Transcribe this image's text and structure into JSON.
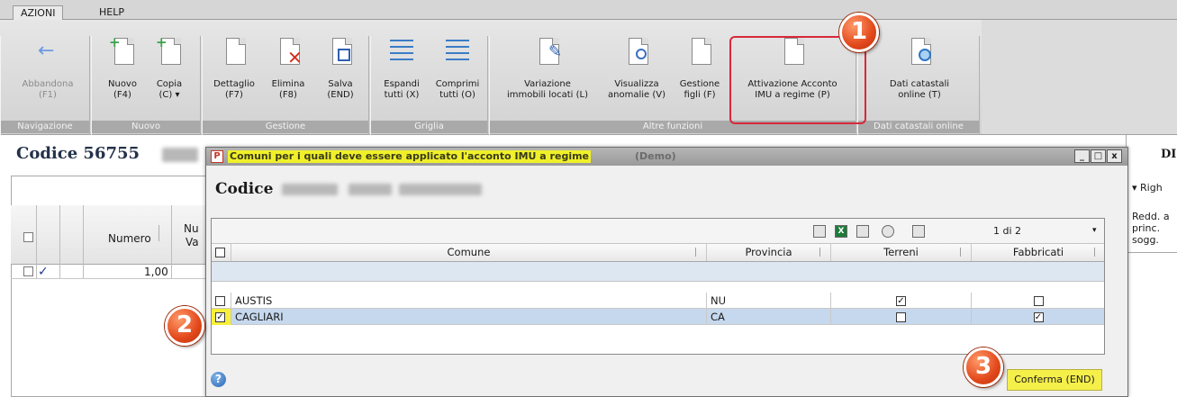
{
  "ribbon": {
    "tabs": [
      {
        "label": "AZIONI"
      },
      {
        "label": "HELP"
      }
    ],
    "groups": {
      "navigazione": {
        "label": "Navigazione",
        "buttons": [
          {
            "line1": "Abbandona",
            "line2": "(F1)"
          }
        ]
      },
      "nuovo": {
        "label": "Nuovo",
        "buttons": [
          {
            "line1": "Nuovo",
            "line2": "(F4)"
          },
          {
            "line1": "Copia",
            "line2": "(C) ▾"
          }
        ]
      },
      "gestione": {
        "label": "Gestione",
        "buttons": [
          {
            "line1": "Dettaglio",
            "line2": "(F7)"
          },
          {
            "line1": "Elimina",
            "line2": "(F8)"
          },
          {
            "line1": "Salva",
            "line2": "(END)"
          }
        ]
      },
      "griglia": {
        "label": "Griglia",
        "buttons": [
          {
            "line1": "Espandi",
            "line2": "tutti (X)"
          },
          {
            "line1": "Comprimi",
            "line2": "tutti (O)"
          }
        ]
      },
      "altre": {
        "label": "Altre funzioni",
        "buttons": [
          {
            "line1": "Variazione",
            "line2": "immobili locati (L)"
          },
          {
            "line1": "Visualizza",
            "line2": "anomalie (V)"
          },
          {
            "line1": "Gestione",
            "line2": "figli (F)"
          },
          {
            "line1": "Attivazione Acconto",
            "line2": "IMU a regime (P)"
          }
        ]
      },
      "catastali": {
        "label": "Dati catastali online",
        "buttons": [
          {
            "line1": "Dati catastali",
            "line2": "online (T)"
          }
        ]
      }
    }
  },
  "background": {
    "codice": "Codice 56755",
    "grid": {
      "col_numero": "Numero",
      "col_nu": "Nu",
      "col_va": "Va",
      "row_value": "1,00"
    },
    "right": {
      "header": "DI",
      "righe": "Righ",
      "redd_line1": "Redd. a",
      "redd_line2": "princ.",
      "redd_line3": "sogg."
    }
  },
  "badges": {
    "one": "1",
    "two": "2",
    "three": "3"
  },
  "dialog": {
    "title": "Comuni per i quali deve essere applicato l'acconto IMU a regime",
    "title_suffix": "(Demo)",
    "app_icon": "P",
    "winbtn_min": "_",
    "winbtn_max": "□",
    "winbtn_close": "x",
    "codice": "Codice",
    "pager": "1 di 2",
    "xl_icon": "X",
    "columns": {
      "comune": "Comune",
      "provincia": "Provincia",
      "terreni": "Terreni",
      "fabbricati": "Fabbricati"
    },
    "rows": [
      {
        "comune": "AUSTIS",
        "provincia": "NU",
        "selected": false,
        "terreni": true,
        "fabbricati": false
      },
      {
        "comune": "CAGLIARI",
        "provincia": "CA",
        "selected": true,
        "terreni": false,
        "fabbricati": true
      }
    ],
    "check_mark": "✓",
    "help_icon": "?",
    "confirm_label": "Conferma (END)"
  }
}
